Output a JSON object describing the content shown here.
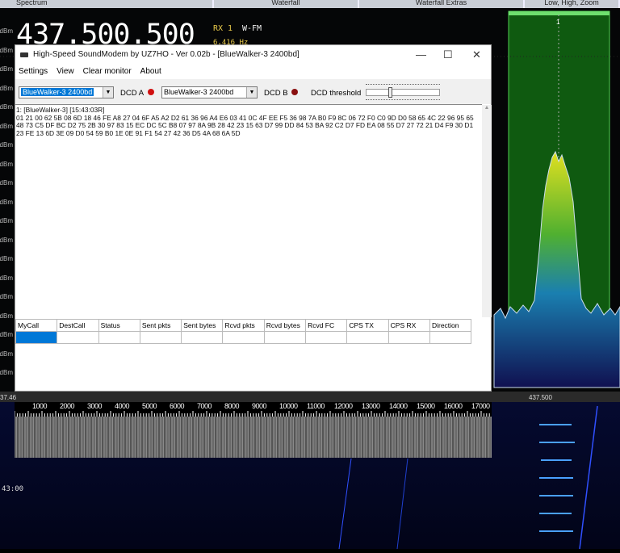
{
  "top_tabs": [
    "Spectrum",
    "Waterfall",
    "Waterfall Extras",
    "Low, High, Zoom"
  ],
  "sdr": {
    "frequency": "437.500.500",
    "rx": "RX 1",
    "mode": "W-FM",
    "offset": "6,416 Hz",
    "filter_label": "1",
    "axis_center": "437.500",
    "axis_left": "37.46",
    "time": "43:00",
    "db_unit": "dBm"
  },
  "window": {
    "title": "High-Speed SoundModem by UZ7HO - Ver 0.02b - [BlueWalker-3 2400bd]",
    "menu": [
      "Settings",
      "View",
      "Clear monitor",
      "About"
    ],
    "modem_a": "BlueWalker-3 2400bd",
    "dcd_a": "DCD A",
    "modem_b": "BlueWalker-3 2400bd",
    "dcd_b": "DCD B",
    "dcd_threshold": "DCD threshold",
    "dcd_a_color": "#d01010",
    "dcd_b_color": "#8a1010",
    "monitor": "1: [BlueWalker-3] [15:43:03R]\n01 21 00 62 5B 08 6D 18 46 FE A8 27 04 6F A5 A2 D2 61 36 96 A4 E6 03 41 0C 4F EE F5 36 98 7A B0 F9 8C 06 72 F0 C0 9D D0 58 65 4C 22 96 95 65\n48 73 C5 DF BC D2 75 2B 30 97 83 15 EC DC 5C B8 07 97 8A 9B 28 42 23 15 63 D7 99 DD 84 53 BA 92 C2 D7 FD EA 08 55 D7 27 72 21 D4 F9 30 D1\n23 FE 13 6D 3E 09 D0 54 59 B0 1E 0E 91 F1 54 27 42 36 D5 4A 68 6A 5D",
    "columns": [
      "MyCall",
      "DestCall",
      "Status",
      "Sent pkts",
      "Sent bytes",
      "Rcvd pkts",
      "Rcvd bytes",
      "Rcvd FC",
      "CPS TX",
      "CPS RX",
      "Direction"
    ]
  },
  "audio_scale": [
    "1000",
    "2000",
    "3000",
    "4000",
    "5000",
    "6000",
    "7000",
    "8000",
    "9000",
    "10000",
    "11000",
    "12000",
    "13000",
    "14000",
    "15000",
    "16000",
    "17000"
  ]
}
